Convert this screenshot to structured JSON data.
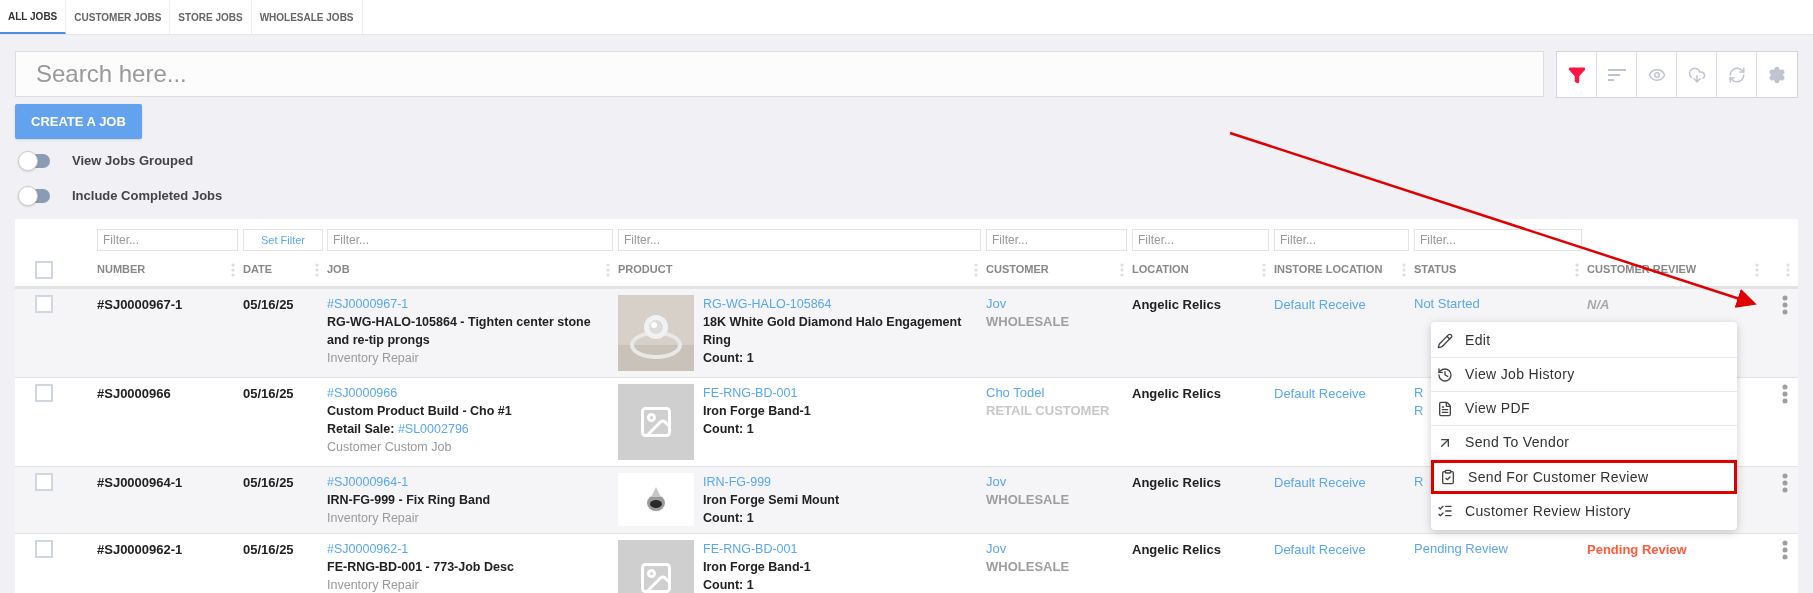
{
  "tabs": [
    {
      "label": "ALL JOBS",
      "selected": true
    },
    {
      "label": "CUSTOMER JOBS",
      "selected": false
    },
    {
      "label": "STORE JOBS",
      "selected": false
    },
    {
      "label": "WHOLESALE JOBS",
      "selected": false
    }
  ],
  "search": {
    "placeholder": "Search here..."
  },
  "toolbar": [
    {
      "kind": "filter",
      "selected": true
    },
    {
      "kind": "sort",
      "selected": false
    },
    {
      "kind": "view",
      "selected": false
    },
    {
      "kind": "download",
      "selected": false
    },
    {
      "kind": "refresh",
      "selected": false
    },
    {
      "kind": "settings",
      "selected": false
    }
  ],
  "create_button": "CREATE A JOB",
  "toggles": [
    {
      "label": "View Jobs Grouped",
      "on": false
    },
    {
      "label": "Include Completed Jobs",
      "on": false
    }
  ],
  "filters": [
    {
      "kind": "input",
      "placeholder": "Filter..."
    },
    {
      "kind": "button",
      "label": "Set Filter"
    },
    {
      "kind": "input",
      "placeholder": "Filter..."
    },
    {
      "kind": "input",
      "placeholder": "Filter..."
    },
    {
      "kind": "input",
      "placeholder": "Filter..."
    },
    {
      "kind": "input",
      "placeholder": "Filter..."
    },
    {
      "kind": "input",
      "placeholder": "Filter..."
    },
    {
      "kind": "input",
      "placeholder": "Filter..."
    }
  ],
  "all_checked": false,
  "columns": [
    "NUMBER",
    "DATE",
    "JOB",
    "PRODUCT",
    "CUSTOMER",
    "LOCATION",
    "INSTORE LOCATION",
    "STATUS",
    "CUSTOMER REVIEW"
  ],
  "rows": [
    {
      "checked": false,
      "number": "#SJ0000967-1",
      "date": "05/16/25",
      "job": {
        "link": "#SJ0000967-1",
        "title": "RG-WG-HALO-105864 - Tighten center stone and re-tip prongs",
        "category": "Inventory Repair"
      },
      "product": {
        "code": "RG-WG-HALO-105864",
        "name": "18K White Gold Diamond Halo Engagement Ring",
        "count": "Count: 1"
      },
      "customer": {
        "name": "Jov",
        "type": "WHOLESALE",
        "color": "#9e9e9e"
      },
      "location": "Angelic Relics",
      "instore": "Default Receive",
      "status": [
        "Not Started"
      ],
      "review": {
        "text": "N/A",
        "kind": "na"
      }
    },
    {
      "checked": false,
      "number": "#SJ0000966",
      "date": "05/16/25",
      "job": {
        "link": "#SJ0000966",
        "title": "Custom Product Build - Cho #1",
        "sale": {
          "label": "Retail Sale:",
          "link": "#SL0002796"
        },
        "category": "Customer Custom Job"
      },
      "product": {
        "kind": "placeholder",
        "code": "FE-RNG-BD-001",
        "name": "Iron Forge Band-1",
        "count": "Count: 1"
      },
      "customer": {
        "name": "Cho Todel",
        "type": "RETAIL CUSTOMER",
        "color": "#c8c8c8"
      },
      "location": "Angelic Relics",
      "instore": "Default Receive",
      "status": [
        "R",
        "R"
      ]
    },
    {
      "checked": false,
      "number": "#SJ0000964-1",
      "date": "05/16/25",
      "job": {
        "link": "#SJ0000964-1",
        "title": "IRN-FG-999 - Fix Ring Band",
        "category": "Inventory Repair"
      },
      "product": {
        "kind": "small-photo",
        "code": "IRN-FG-999",
        "name": "Iron Forge Semi Mount",
        "count": "Count: 1"
      },
      "customer": {
        "name": "Jov",
        "type": "WHOLESALE",
        "color": "#9e9e9e"
      },
      "location": "Angelic Relics",
      "instore": "Default Receive",
      "status": [
        "R"
      ]
    },
    {
      "checked": false,
      "number": "#SJ0000962-1",
      "date": "05/16/25",
      "job": {
        "link": "#SJ0000962-1",
        "title": "FE-RNG-BD-001 - 773-Job Desc",
        "category": "Inventory Repair"
      },
      "product": {
        "kind": "placeholder",
        "code": "FE-RNG-BD-001",
        "name": "Iron Forge Band-1",
        "count": "Count: 1"
      },
      "customer": {
        "name": "Jov",
        "type": "WHOLESALE",
        "color": "#9e9e9e"
      },
      "location": "Angelic Relics",
      "instore": "Default Receive",
      "status": [
        "Pending Review"
      ],
      "review": {
        "text": "Pending Review",
        "kind": "pending"
      }
    }
  ],
  "menu": [
    {
      "kind": "edit",
      "label": "Edit",
      "highlighted": false
    },
    {
      "kind": "history",
      "label": "View Job History",
      "highlighted": false
    },
    {
      "kind": "pdf",
      "label": "View PDF",
      "highlighted": false
    },
    {
      "kind": "vendor",
      "label": "Send To Vendor",
      "highlighted": false
    },
    {
      "kind": "review",
      "label": "Send For Customer Review",
      "highlighted": true
    },
    {
      "kind": "review-history",
      "label": "Customer Review History",
      "highlighted": false
    }
  ]
}
